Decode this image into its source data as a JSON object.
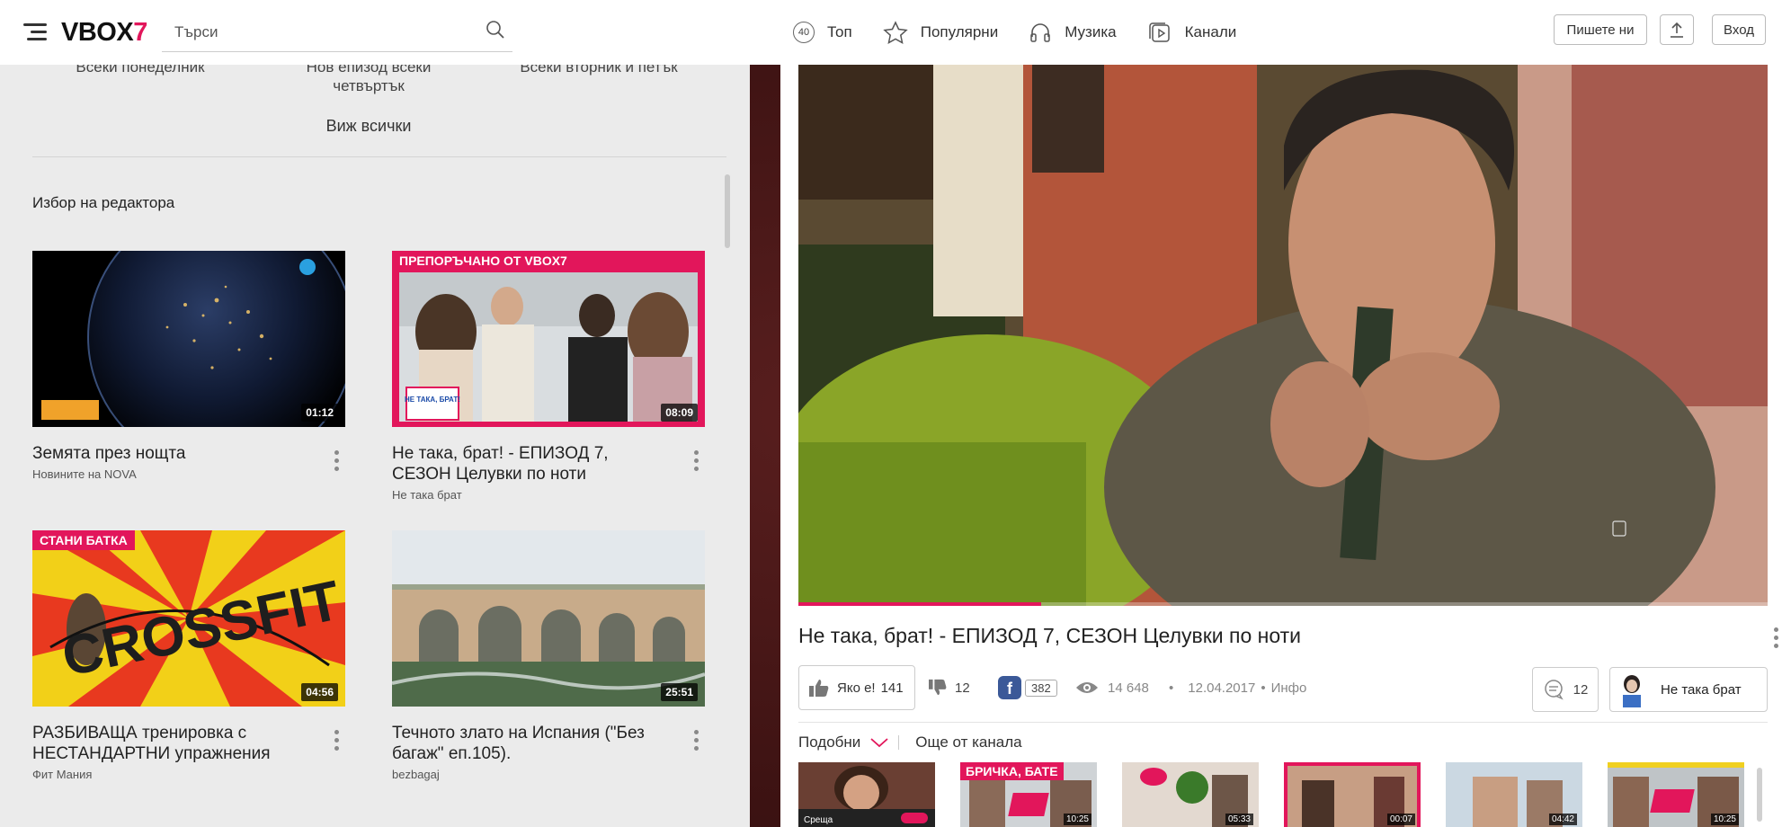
{
  "header": {
    "logo_text": "VBOX",
    "logo_number": "7",
    "search_placeholder": "Търси",
    "nav": [
      {
        "badge": "40",
        "label": "Топ",
        "icon": "badge-40-icon"
      },
      {
        "label": "Популярни",
        "icon": "star-icon"
      },
      {
        "label": "Музика",
        "icon": "headphones-icon"
      },
      {
        "label": "Канали",
        "icon": "channels-icon"
      }
    ],
    "write_us": "Пишете ни",
    "upload_icon": "upload-icon",
    "login": "Вход"
  },
  "schedule": [
    "Всеки понеделник",
    "Нов епизод всеки четвъртък",
    "Всеки вторник и петък"
  ],
  "see_all": "Виж всички",
  "editors_pick": {
    "title": "Избор на редактора",
    "cards": [
      {
        "title": "Земята през нощта",
        "channel": "Новините на NOVA",
        "duration": "01:12",
        "tag": ""
      },
      {
        "title": "Не така, брат! - ЕПИЗОД 7, СЕЗОН Целувки по ноти",
        "channel": "Не така брат",
        "duration": "08:09",
        "tag": "ПРЕПОРЪЧАНО ОТ VBOX7",
        "badge_text": "НЕ ТАКА, БРАТ!"
      },
      {
        "title": "РАЗБИВАЩА тренировка с НЕСТАНДАРТНИ упражнения",
        "channel": "Фит Мания",
        "duration": "04:56",
        "tag": "СТАНИ БАТКА",
        "thumb_text": "CROSSFIT"
      },
      {
        "title": "Течното злато на Испания (\"Без багаж\" еп.105).",
        "channel": "bezbagaj",
        "duration": "25:51",
        "tag": ""
      }
    ]
  },
  "video": {
    "title": "Не така, брат! - ЕПИЗОД 7, СЕЗОН Целувки по ноти",
    "progress": 0.25,
    "like_label": "Яко е!",
    "likes": "141",
    "dislikes": "12",
    "facebook_shares": "382",
    "views": "14 648",
    "date": "12.04.2017",
    "info": "Инфо",
    "comments": "12",
    "channel_name": "Не така брат"
  },
  "tabs": {
    "similar": "Подобни",
    "more_from_channel": "Още от канала"
  },
  "related": [
    {
      "duration": "",
      "tag": "",
      "label": "Среща"
    },
    {
      "duration": "10:25",
      "tag": "БРИЧКА, БАТЕ",
      "label": ""
    },
    {
      "duration": "05:33",
      "tag": "",
      "label": ""
    },
    {
      "duration": "00:07",
      "tag": "",
      "label": ""
    },
    {
      "duration": "04:42",
      "tag": "",
      "label": ""
    },
    {
      "duration": "10:25",
      "tag": "",
      "label": ""
    }
  ],
  "colors": {
    "accent": "#e2165b",
    "panel_bg": "#ebebeb"
  }
}
